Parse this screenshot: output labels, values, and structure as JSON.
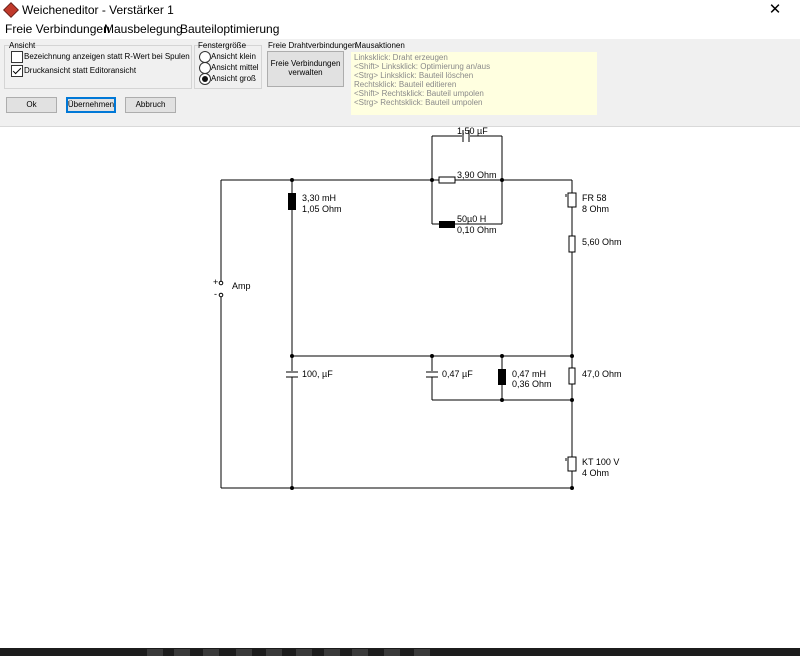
{
  "window": {
    "title": "Weicheneditor - Verstärker 1"
  },
  "menu": [
    "Freie Verbindungen",
    "Mausbelegung",
    "Bauteiloptimierung"
  ],
  "ansicht": {
    "title": "Ansicht",
    "options": [
      {
        "label": "Bezeichnung anzeigen statt R-Wert bei Spulen",
        "checked": false
      },
      {
        "label": "Druckansicht statt Editoransicht",
        "checked": true
      }
    ]
  },
  "fenstergroesse": {
    "title": "Fenstergröße",
    "options": [
      {
        "label": "Ansicht klein",
        "selected": false
      },
      {
        "label": "Ansicht mittel",
        "selected": false
      },
      {
        "label": "Ansicht groß",
        "selected": true
      }
    ]
  },
  "freie": {
    "title": "Freie Drahtverbindungen",
    "button_line1": "Freie Verbindungen",
    "button_line2": "verwalten"
  },
  "mausaktionen": {
    "title": "Mausaktionen",
    "lines": [
      "Linksklick: Draht erzeugen",
      "<Shift> Linksklick: Optimierung an/aus",
      "<Strg> Linksklick: Bauteil löschen",
      "Rechtsklick: Bauteil editieren",
      "<Shift> Rechtsklick: Bauteil umpolen",
      "<Strg> Rechtsklick: Bauteil umpolen"
    ]
  },
  "buttons": {
    "ok": "Ok",
    "apply": "Übernehmen",
    "cancel": "Abbruch"
  },
  "circuit": {
    "amp": {
      "label": "Amp",
      "plus": "+",
      "minus": "-"
    },
    "c_top": "1,50 µF",
    "r_top": "3,90 Ohm",
    "l_mid_1": "50µ0 H",
    "l_mid_2": "0,10 Ohm",
    "l_left_1": "3,30 mH",
    "l_left_2": "1,05 Ohm",
    "spk_fr_1": "FR 58",
    "spk_fr_2": "8 Ohm",
    "r_series": "5,60 Ohm",
    "c_left": "100, µF",
    "c_mid": "0,47 µF",
    "l_low_1": "0,47 mH",
    "l_low_2": "0,36 Ohm",
    "r_right": "47,0 Ohm",
    "spk_kt_1": "KT 100 V",
    "spk_kt_2": "4 Ohm"
  }
}
